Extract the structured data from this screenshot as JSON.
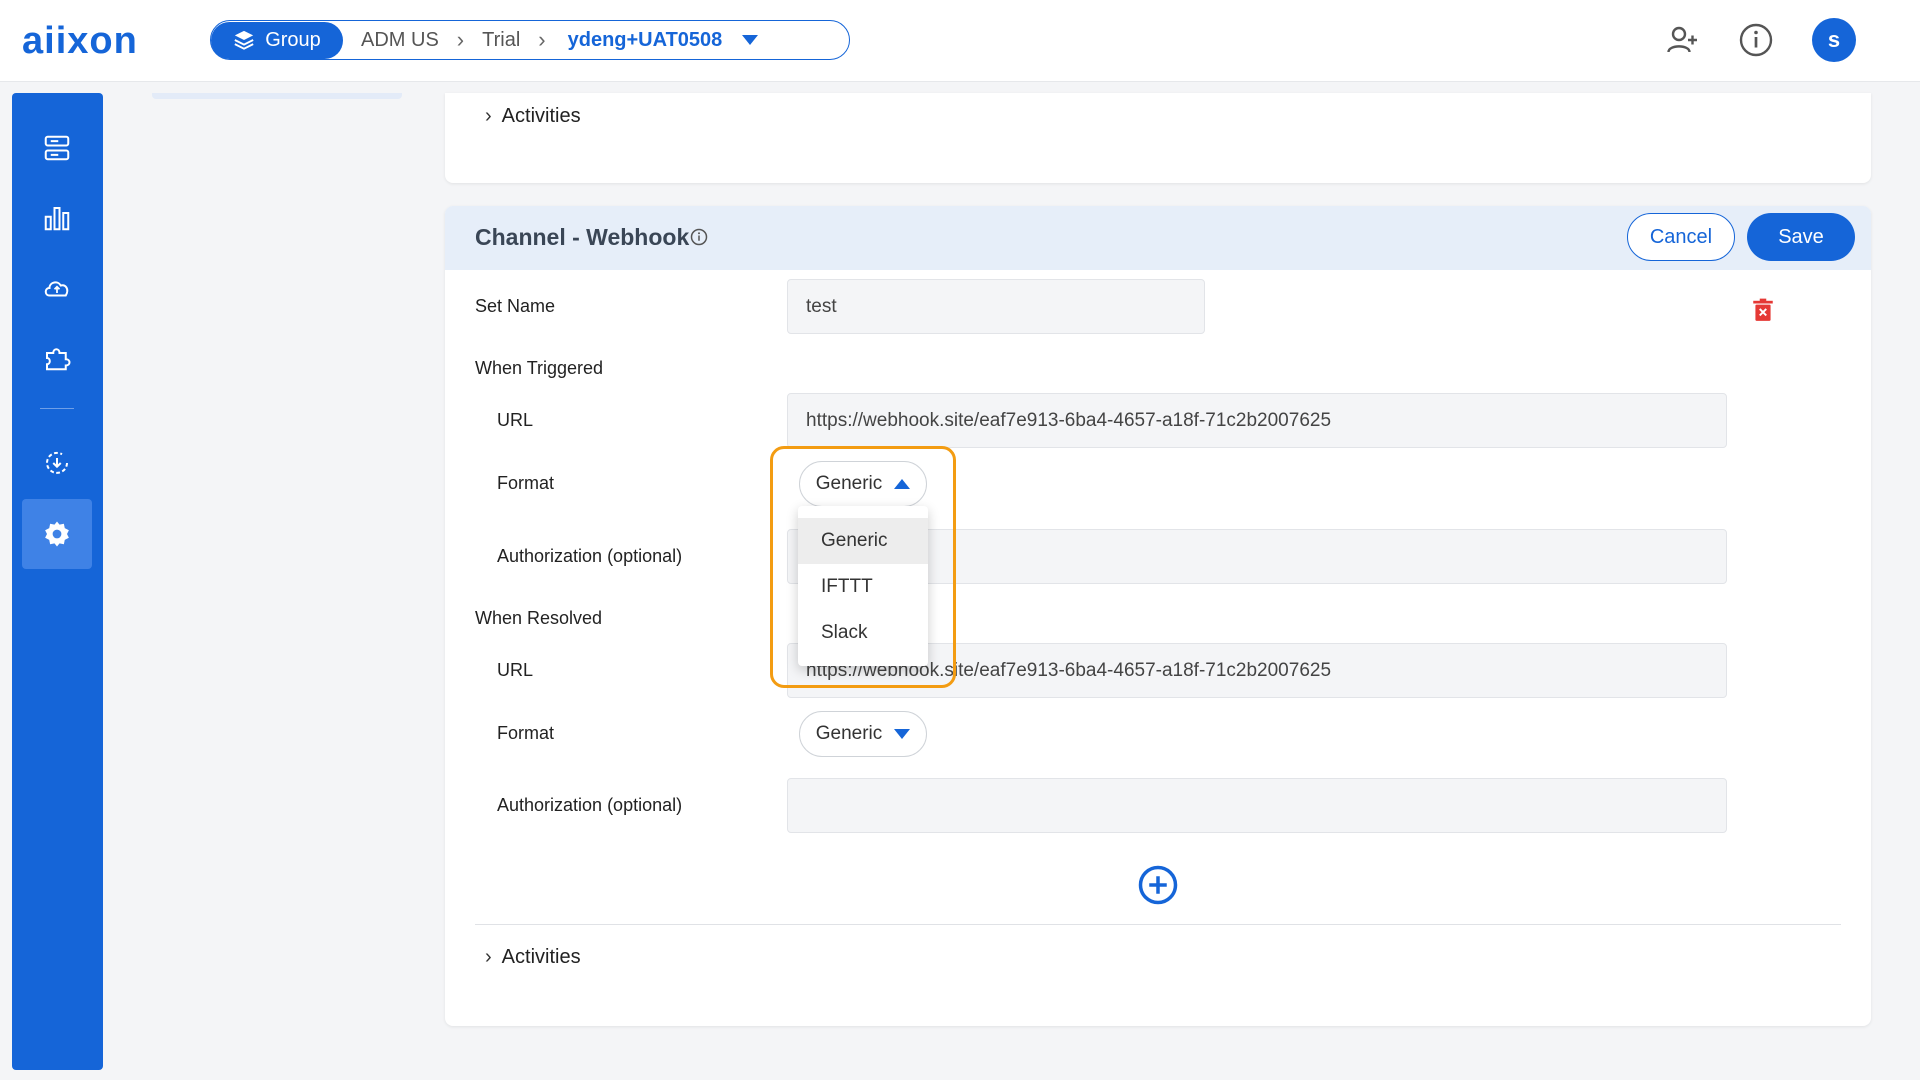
{
  "header": {
    "logo": "aiixon",
    "breadcrumb": {
      "group_label": "Group",
      "items": [
        "ADM US",
        "Trial"
      ],
      "active": "ydeng+UAT0508"
    },
    "avatar_initial": "s"
  },
  "top_card": {
    "activities_label": "Activities"
  },
  "channel": {
    "title": "Channel - Webhook",
    "cancel_label": "Cancel",
    "save_label": "Save",
    "set_name_label": "Set Name",
    "set_name_value": "test",
    "when_triggered": {
      "heading": "When Triggered",
      "url_label": "URL",
      "url_value": "https://webhook.site/eaf7e913-6ba4-4657-a18f-71c2b2007625",
      "format_label": "Format",
      "format_value": "Generic",
      "auth_label": "Authorization (optional)",
      "auth_value": ""
    },
    "when_resolved": {
      "heading": "When Resolved",
      "url_label": "URL",
      "url_value": "https://webhook.site/eaf7e913-6ba4-4657-a18f-71c2b2007625",
      "format_label": "Format",
      "format_value": "Generic",
      "auth_label": "Authorization (optional)",
      "auth_value": ""
    },
    "format_options": [
      "Generic",
      "IFTTT",
      "Slack"
    ],
    "activities_label": "Activities"
  },
  "colors": {
    "accent": "#1565d8",
    "highlight": "#f39c12",
    "danger": "#e53935"
  }
}
